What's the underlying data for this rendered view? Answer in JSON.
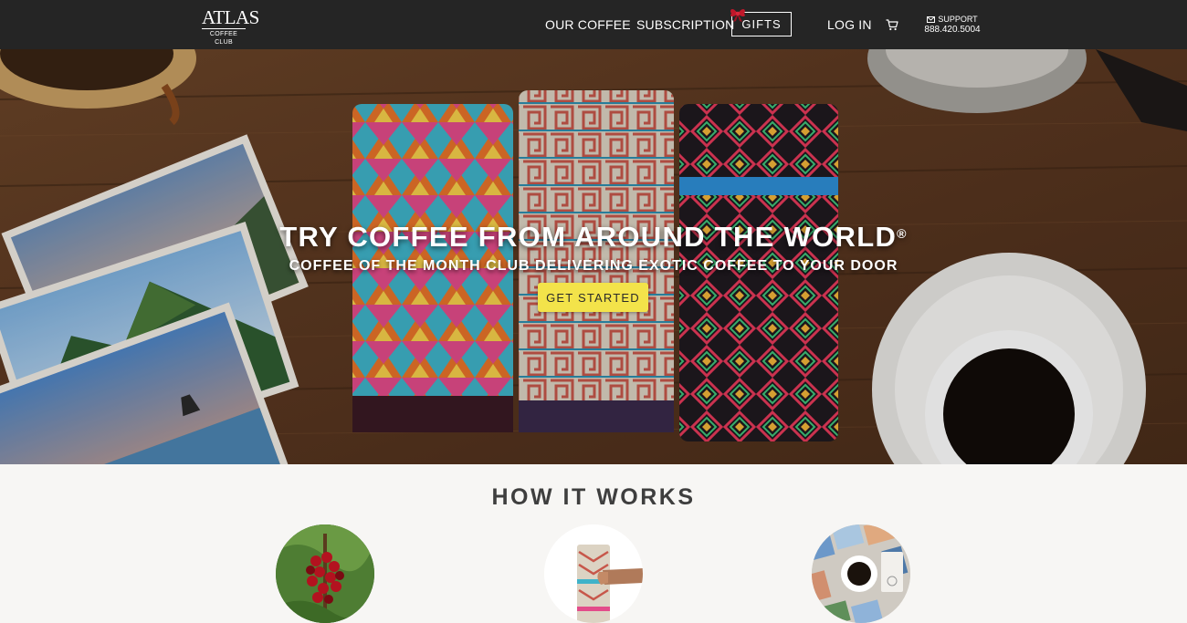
{
  "header": {
    "logo": {
      "main": "ATLAS",
      "sub": "COFFEE CLUB"
    },
    "nav": {
      "our_coffee": "OUR COFFEE",
      "subscription": "SUBSCRIPTION",
      "gifts": "GIFTS",
      "login": "LOG IN"
    },
    "icons": {
      "gift": "bow-icon",
      "cart": "cart-icon",
      "mail": "mail-icon"
    },
    "support": {
      "label": "SUPPORT",
      "phone": "888.420.5004"
    }
  },
  "hero": {
    "title": "TRY COFFEE FROM AROUND THE WORLD",
    "title_mark": "®",
    "subtitle": "COFFEE OF THE MONTH CLUB DELIVERING EXOTIC COFFEE TO YOUR DOOR",
    "cta": "GET STARTED",
    "cta_color": "#f3e34a"
  },
  "how_it_works": {
    "title": "HOW IT WORKS",
    "steps": [
      {
        "icon": "coffee-cherries-image"
      },
      {
        "icon": "coffee-bag-in-hand-image"
      },
      {
        "icon": "coffee-and-postcards-image"
      }
    ]
  },
  "colors": {
    "header_bg": "#252525",
    "page_bg": "#f7f6f4",
    "title_text": "#3e3e3e"
  }
}
